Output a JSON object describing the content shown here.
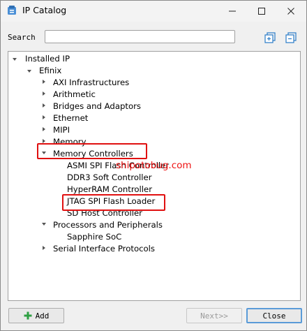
{
  "window": {
    "title": "IP Catalog"
  },
  "search": {
    "label": "Search",
    "value": "",
    "placeholder": ""
  },
  "toolbar": {
    "expand_icon": "expand-all-icon",
    "collapse_icon": "collapse-all-icon"
  },
  "tree": {
    "root": "Installed IP",
    "vendor": "Efinix",
    "categories": [
      "AXI Infrastructures",
      "Arithmetic",
      "Bridges and Adaptors",
      "Ethernet",
      "MIPI",
      "Memory",
      "Memory Controllers",
      "Processors and Peripherals",
      "Serial Interface Protocols"
    ],
    "memory_controllers_children": [
      "ASMI SPI Flash Controller",
      "DDR3 Soft Controller",
      "HyperRAM Controller",
      "JTAG SPI Flash Loader",
      "SD Host Controller"
    ],
    "processors_children": [
      "Sapphire SoC"
    ]
  },
  "watermark": "shipotobug.com",
  "buttons": {
    "add": "Add",
    "next": "Next>>",
    "close": "Close"
  },
  "colors": {
    "highlight": "#e01010",
    "add_icon": "#2ea043",
    "accent": "#5a9bd8"
  }
}
